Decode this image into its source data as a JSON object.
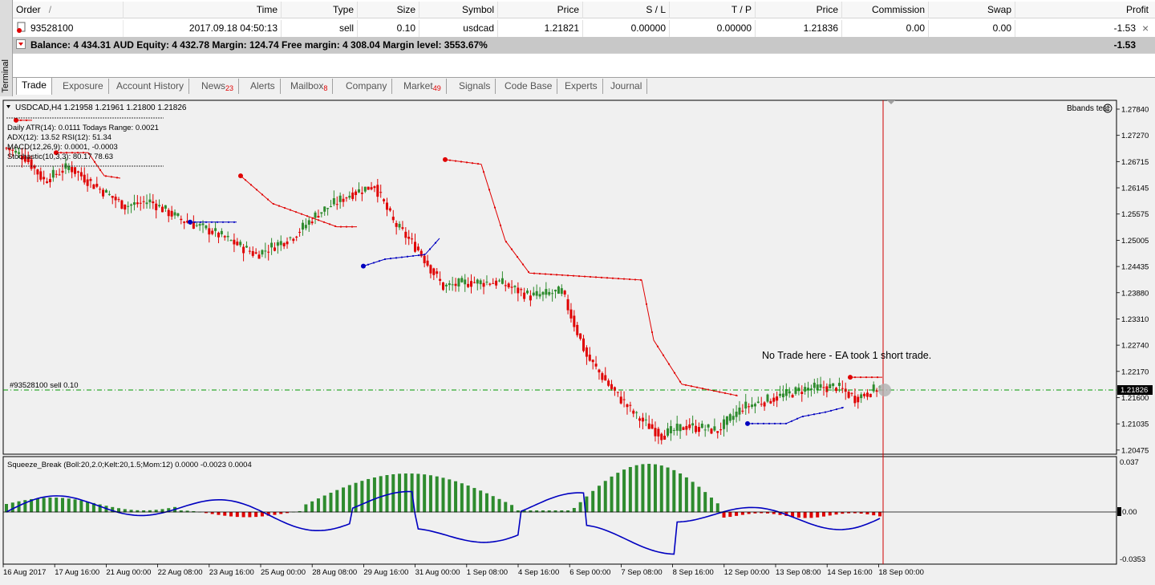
{
  "window": {
    "side_tab_label": "Terminal"
  },
  "trade_table": {
    "columns": [
      "Order",
      "Time",
      "Type",
      "Size",
      "Symbol",
      "Price",
      "S / L",
      "T / P",
      "Price",
      "Commission",
      "Swap",
      "Profit"
    ],
    "sort_indicator": "/",
    "order": {
      "id": "93528100",
      "time": "2017.09.18 04:50:13",
      "type": "sell",
      "size": "0.10",
      "symbol": "usdcad",
      "open_price": "1.21821",
      "sl": "0.00000",
      "tp": "0.00000",
      "current_price": "1.21836",
      "commission": "0.00",
      "swap": "0.00",
      "profit": "-1.53"
    },
    "balance_line": "Balance: 4 434.31 AUD  Equity: 4 432.78  Margin: 124.74  Free margin: 4 308.04  Margin level: 3553.67%",
    "balance_profit": "-1.53",
    "close_glyph": "×"
  },
  "tabs": [
    {
      "label": "Trade",
      "badge": ""
    },
    {
      "label": "Exposure",
      "badge": ""
    },
    {
      "label": "Account History",
      "badge": ""
    },
    {
      "label": "News",
      "badge": "23"
    },
    {
      "label": "Alerts",
      "badge": ""
    },
    {
      "label": "Mailbox",
      "badge": "8"
    },
    {
      "label": "Company",
      "badge": ""
    },
    {
      "label": "Market",
      "badge": "49"
    },
    {
      "label": "Signals",
      "badge": ""
    },
    {
      "label": "Code Base",
      "badge": ""
    },
    {
      "label": "Experts",
      "badge": ""
    },
    {
      "label": "Journal",
      "badge": ""
    }
  ],
  "chart": {
    "header": "USDCAD,H4  1.21958 1.21961 1.21800 1.21826",
    "info_lines": [
      "Daily ATR(14): 0.0111 Todays Range: 0.0021",
      "ADX(12): 13.52 RSI(12): 51.34",
      "MACD(12,26,9): 0.0001, -0.0003",
      "Stochastic(10,3,3): 80.17 78.63"
    ],
    "ea_label": "Bbands test",
    "annotation": "No Trade here - EA took 1 short trade.",
    "order_line_label": "#93528100 sell 0.10",
    "current_price_label": "1.21826",
    "colors": {
      "bull": "#2e8b2e",
      "bear": "#e00000",
      "band_upper": "#e00000",
      "band_lower": "#0000c0",
      "order_line": "#009900"
    }
  },
  "indicator": {
    "header": "Squeeze_Break (Boll:20,2.0;Kelt:20,1.5;Mom:12) 0.0000 -0.0023 0.0004",
    "scale_labels": [
      "0.037",
      "0.00",
      "-0.0353"
    ]
  },
  "chart_data": {
    "type": "candlestick",
    "title": "USDCAD,H4",
    "y_axis_labels": [
      "1.27840",
      "1.27270",
      "1.26715",
      "1.26145",
      "1.25575",
      "1.25005",
      "1.24435",
      "1.23880",
      "1.23310",
      "1.22740",
      "1.22170",
      "1.21600",
      "1.21035",
      "1.20475"
    ],
    "x_axis_labels": [
      "16 Aug 2017",
      "17 Aug 16:00",
      "21 Aug 00:00",
      "22 Aug 08:00",
      "23 Aug 16:00",
      "25 Aug 00:00",
      "28 Aug 08:00",
      "29 Aug 16:00",
      "31 Aug 00:00",
      "1 Sep 08:00",
      "4 Sep 16:00",
      "6 Sep 00:00",
      "7 Sep 08:00",
      "8 Sep 16:00",
      "12 Sep 00:00",
      "13 Sep 08:00",
      "14 Sep 16:00",
      "18 Sep 00:00"
    ],
    "ylim": [
      1.2044,
      1.2793
    ]
  }
}
